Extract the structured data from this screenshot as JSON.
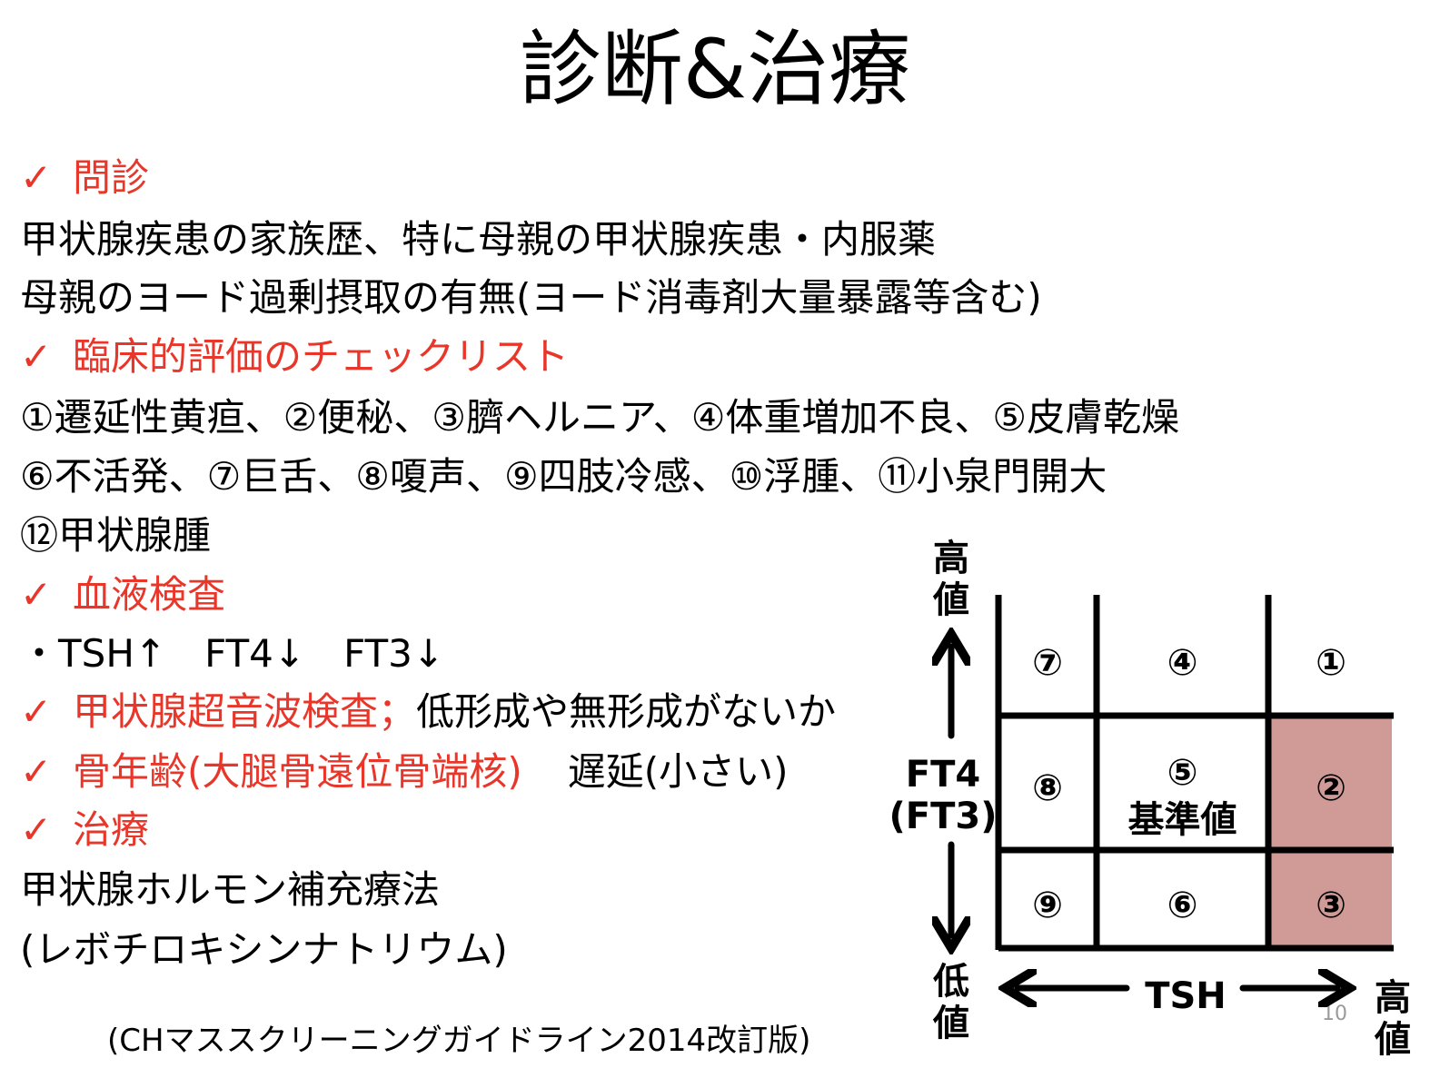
{
  "title": "診断&治療",
  "check_mark": "✓",
  "sections": {
    "interview": {
      "heading": "問診",
      "lines": [
        "甲状腺疾患の家族歴、特に母親の甲状腺疾患・内服薬",
        "母親のヨード過剰摂取の有無(ヨード消毒剤大量暴露等含む)"
      ]
    },
    "checklist": {
      "heading": "臨床的評価のチェックリスト",
      "lines": [
        "①遷延性黄疸、②便秘、③臍ヘルニア、④体重増加不良、⑤皮膚乾燥",
        "⑥不活発、⑦巨舌、⑧嗄声、⑨四肢冷感、⑩浮腫、⑪小泉門開大",
        "⑫甲状腺腫"
      ]
    },
    "blood": {
      "heading": "血液検査",
      "line": "・TSH↑　FT4↓　FT3↓"
    },
    "ultrasound": {
      "heading": "甲状腺超音波検査；",
      "detail": "低形成や無形成がないか"
    },
    "bone_age": {
      "heading": "骨年齢(大腿骨遠位骨端核)",
      "detail": "遅延(小さい)"
    },
    "treatment": {
      "heading": "治療",
      "lines": [
        "甲状腺ホルモン補充療法",
        "(レボチロキシンナトリウム)"
      ]
    }
  },
  "source": "(CHマススクリーニングガイドライン2014改訂版)",
  "page_number": "10",
  "diagram": {
    "y_high": "高\n値",
    "y_low": "低\n値",
    "y_axis_label": "FT4\n(FT3)",
    "x_axis_label": "TSH",
    "x_high": "高\n値",
    "highlight_color": "#d09a96",
    "cells": {
      "c7": "⑦",
      "c4": "④",
      "c1": "①",
      "c8": "⑧",
      "c5": "⑤",
      "c5_sub": "基準値",
      "c2": "②",
      "c9": "⑨",
      "c6": "⑥",
      "c3": "③"
    }
  }
}
